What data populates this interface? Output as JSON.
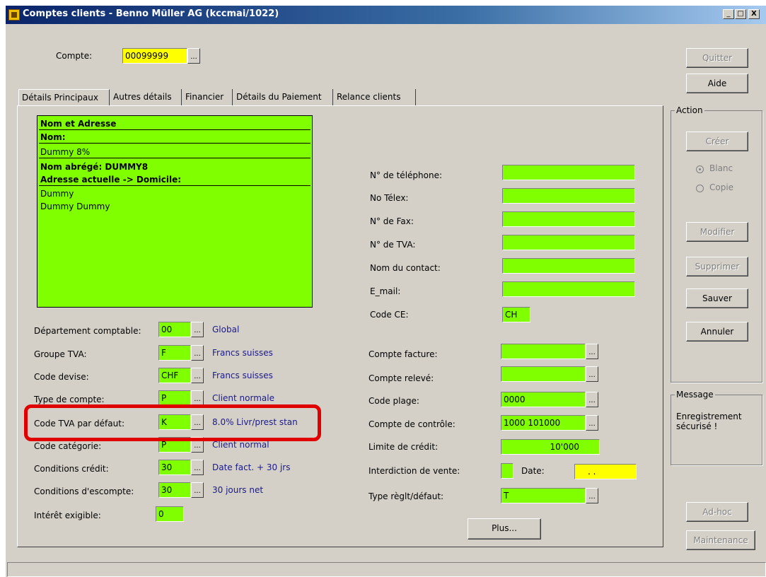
{
  "window": {
    "title": "Comptes clients - Benno Müller AG (kccmai/1022)",
    "minimize": "_",
    "maximize": "□",
    "close": "X"
  },
  "account": {
    "label": "Compte:",
    "value": "00099999",
    "browse": "..."
  },
  "buttons": {
    "quit": "Quitter",
    "help": "Aide",
    "create": "Créer",
    "modify": "Modifier",
    "delete": "Supprimer",
    "save": "Sauver",
    "cancel": "Annuler",
    "plus": "Plus...",
    "adhoc": "Ad-hoc",
    "maintenance": "Maintenance"
  },
  "tabs": [
    {
      "label": "Détails Principaux",
      "active": true
    },
    {
      "label": "Autres détails"
    },
    {
      "label": "Financier"
    },
    {
      "label": "Détails du Paiement"
    },
    {
      "label": "Relance clients"
    }
  ],
  "name_panel": {
    "header": "Nom et Adresse",
    "name_label": "Nom:",
    "name_value": "Dummy 8%",
    "short_name": "Nom abrégé: DUMMY8",
    "address_label": "Adresse actuelle -> Domicile:",
    "address_line1": "Dummy",
    "address_line2": "Dummy  Dummy"
  },
  "left_fields": [
    {
      "label": "Département comptable:",
      "value": "00",
      "desc": "Global"
    },
    {
      "label": "Groupe TVA:",
      "value": "F",
      "desc": "Francs suisses"
    },
    {
      "label": "Code devise:",
      "value": "CHF",
      "desc": "Francs suisses"
    },
    {
      "label": "Type de compte:",
      "value": "P",
      "desc": "Client normale"
    },
    {
      "label": "Code TVA par défaut:",
      "value": "K",
      "desc": "8.0% Livr/prest stan"
    },
    {
      "label": "Code catégorie:",
      "value": "P",
      "desc": "Client normal"
    },
    {
      "label": "Conditions crédit:",
      "value": "30",
      "desc": "Date fact. + 30 jrs"
    },
    {
      "label": "Conditions d'escompte:",
      "value": "30",
      "desc": "30 jours net"
    },
    {
      "label": "Intérêt exigible:",
      "value": "0"
    }
  ],
  "contact_fields": [
    {
      "label": "N° de téléphone:",
      "value": ""
    },
    {
      "label": "No Télex:",
      "value": ""
    },
    {
      "label": "N° de Fax:",
      "value": ""
    },
    {
      "label": "N° de TVA:",
      "value": ""
    },
    {
      "label": "Nom du contact:",
      "value": ""
    },
    {
      "label": "E_mail:",
      "value": ""
    },
    {
      "label": "Code CE:",
      "value": "CH"
    }
  ],
  "right_fields": [
    {
      "label": "Compte facture:",
      "value": ""
    },
    {
      "label": "Compte relevé:",
      "value": ""
    },
    {
      "label": "Code plage:",
      "value": "0000"
    },
    {
      "label": "Compte de contrôle:",
      "value": "1000 101000"
    },
    {
      "label": "Limite de crédit:",
      "value": "10'000"
    },
    {
      "label": "Interdiction de vente:",
      "value": ""
    },
    {
      "label": "Type règlt/défaut:",
      "value": "T"
    }
  ],
  "date": {
    "label": "Date:",
    "value": ". ."
  },
  "action": {
    "title": "Action",
    "blank": "Blanc",
    "copy": "Copie"
  },
  "message": {
    "title": "Message",
    "text_line1": "Enregistrement",
    "text_line2": "sécurisé !"
  },
  "highlight_color": "#e00000"
}
